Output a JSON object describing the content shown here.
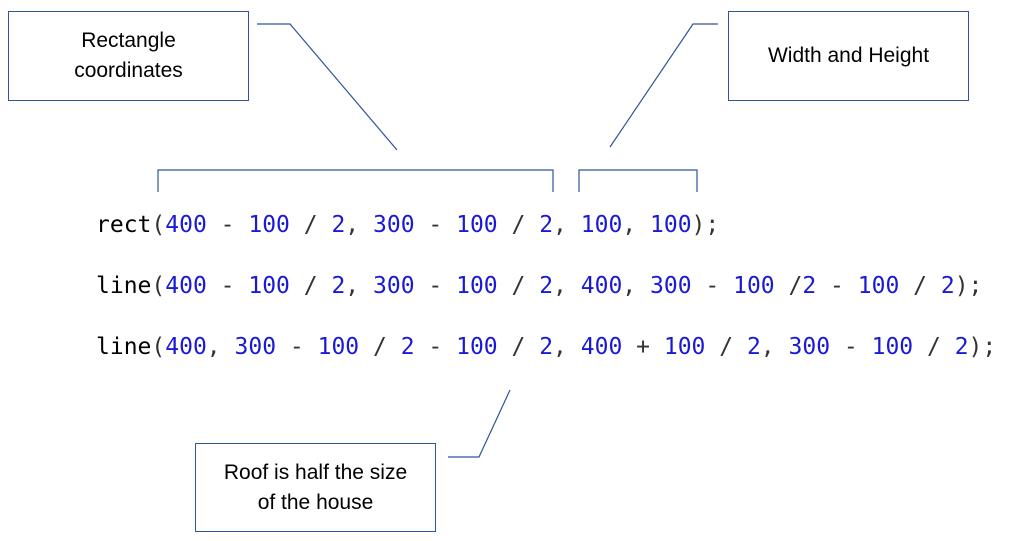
{
  "callouts": {
    "rectangle_coordinates": "Rectangle\ncoordinates",
    "width_and_height": "Width and Height",
    "roof": "Roof is half the size\nof the house"
  },
  "code_lines": [
    [
      {
        "t": "fn",
        "v": "rect"
      },
      {
        "t": "op",
        "v": "("
      },
      {
        "t": "num",
        "v": "400"
      },
      {
        "t": "op",
        "v": " - "
      },
      {
        "t": "num",
        "v": "100"
      },
      {
        "t": "op",
        "v": " / "
      },
      {
        "t": "num",
        "v": "2"
      },
      {
        "t": "op",
        "v": ", "
      },
      {
        "t": "num",
        "v": "300"
      },
      {
        "t": "op",
        "v": " - "
      },
      {
        "t": "num",
        "v": "100"
      },
      {
        "t": "op",
        "v": " / "
      },
      {
        "t": "num",
        "v": "2"
      },
      {
        "t": "op",
        "v": ", "
      },
      {
        "t": "num",
        "v": "100"
      },
      {
        "t": "op",
        "v": ", "
      },
      {
        "t": "num",
        "v": "100"
      },
      {
        "t": "op",
        "v": ");"
      }
    ],
    [
      {
        "t": "fn",
        "v": "line"
      },
      {
        "t": "op",
        "v": "("
      },
      {
        "t": "num",
        "v": "400"
      },
      {
        "t": "op",
        "v": " - "
      },
      {
        "t": "num",
        "v": "100"
      },
      {
        "t": "op",
        "v": " / "
      },
      {
        "t": "num",
        "v": "2"
      },
      {
        "t": "op",
        "v": ", "
      },
      {
        "t": "num",
        "v": "300"
      },
      {
        "t": "op",
        "v": " - "
      },
      {
        "t": "num",
        "v": "100"
      },
      {
        "t": "op",
        "v": " / "
      },
      {
        "t": "num",
        "v": "2"
      },
      {
        "t": "op",
        "v": ", "
      },
      {
        "t": "num",
        "v": "400"
      },
      {
        "t": "op",
        "v": ", "
      },
      {
        "t": "num",
        "v": "300"
      },
      {
        "t": "op",
        "v": " - "
      },
      {
        "t": "num",
        "v": "100"
      },
      {
        "t": "op",
        "v": " /"
      },
      {
        "t": "num",
        "v": "2"
      },
      {
        "t": "op",
        "v": " - "
      },
      {
        "t": "num",
        "v": "100"
      },
      {
        "t": "op",
        "v": " / "
      },
      {
        "t": "num",
        "v": "2"
      },
      {
        "t": "op",
        "v": ");"
      }
    ],
    [
      {
        "t": "fn",
        "v": "line"
      },
      {
        "t": "op",
        "v": "("
      },
      {
        "t": "num",
        "v": "400"
      },
      {
        "t": "op",
        "v": ", "
      },
      {
        "t": "num",
        "v": "300"
      },
      {
        "t": "op",
        "v": " - "
      },
      {
        "t": "num",
        "v": "100"
      },
      {
        "t": "op",
        "v": " / "
      },
      {
        "t": "num",
        "v": "2"
      },
      {
        "t": "op",
        "v": " - "
      },
      {
        "t": "num",
        "v": "100"
      },
      {
        "t": "op",
        "v": " / "
      },
      {
        "t": "num",
        "v": "2"
      },
      {
        "t": "op",
        "v": ", "
      },
      {
        "t": "num",
        "v": "400"
      },
      {
        "t": "op",
        "v": " + "
      },
      {
        "t": "num",
        "v": "100"
      },
      {
        "t": "op",
        "v": " / "
      },
      {
        "t": "num",
        "v": "2"
      },
      {
        "t": "op",
        "v": ", "
      },
      {
        "t": "num",
        "v": "300"
      },
      {
        "t": "op",
        "v": " - "
      },
      {
        "t": "num",
        "v": "100"
      },
      {
        "t": "op",
        "v": " / "
      },
      {
        "t": "num",
        "v": "2"
      },
      {
        "t": "op",
        "v": ");"
      }
    ]
  ],
  "colors": {
    "callout_border": "#2f5597",
    "code_number": "#1a1ad6",
    "code_text": "#000000"
  }
}
